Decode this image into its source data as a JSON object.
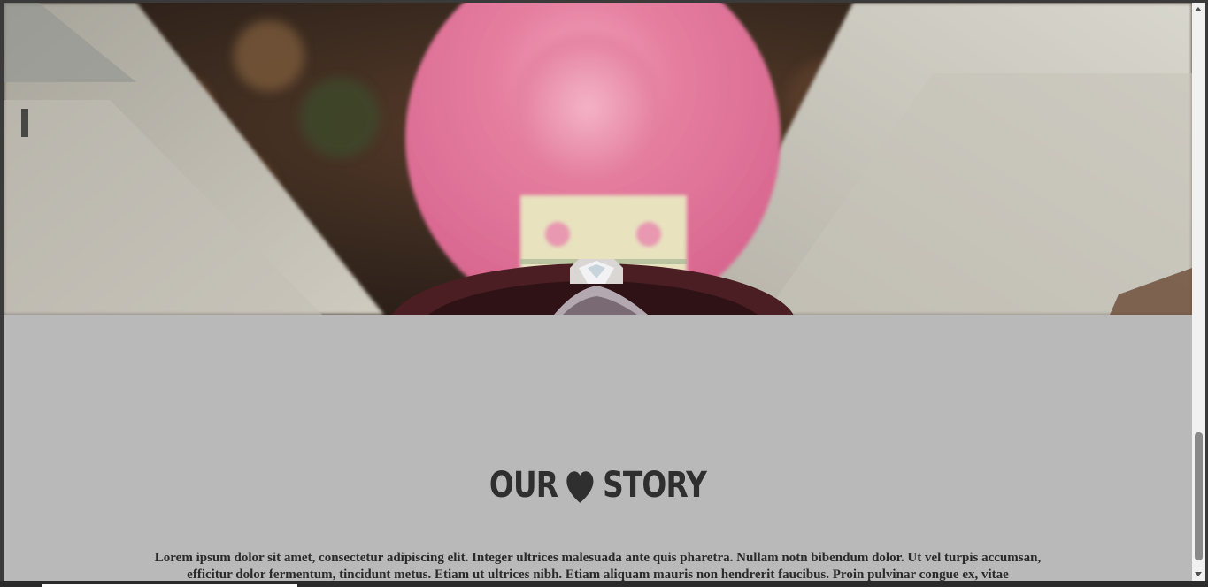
{
  "hero": {
    "image_icon": "engagement-ring-box-photo",
    "colors": {
      "pink": "#e0739a",
      "wood": "#4a3a30",
      "plank": "#c9c6bc"
    }
  },
  "story": {
    "title_left": "OUR",
    "title_icon": "heart-icon",
    "title_right": "STORY",
    "body_line1": "Lorem ipsum dolor sit amet, consectetur adipiscing elit. Integer ultrices malesuada ante quis pharetra. Nullam notn bibendum dolor. Ut vel turpis accumsan,",
    "body_line2": "efficitur dolor fermentum, tincidunt metus. Etiam ut ultrices nibh. Etiam aliquam mauris non hendrerit faucibus. Proin pulvinar congue ex, vitae"
  },
  "colors": {
    "section_bg": "#b9b9b9",
    "title": "#2f2f2f"
  }
}
